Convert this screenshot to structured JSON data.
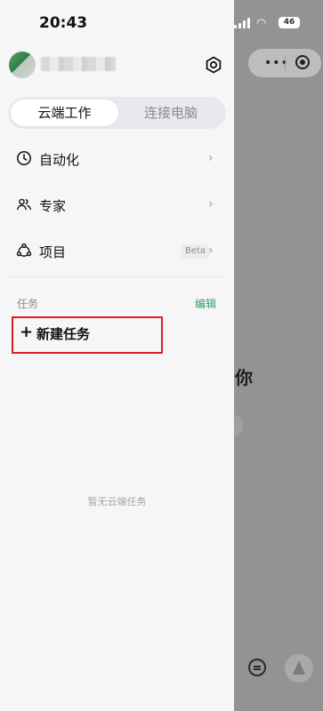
{
  "status_bar": {
    "time": "20:43",
    "battery": "46"
  },
  "background": {
    "greeting": "你"
  },
  "drawer": {
    "tabs": [
      {
        "label": "云端工作",
        "active": true
      },
      {
        "label": "连接电脑",
        "active": false
      }
    ],
    "menu": [
      {
        "label": "自动化",
        "icon": "clock-icon"
      },
      {
        "label": "专家",
        "icon": "users-icon"
      },
      {
        "label": "项目",
        "icon": "project-icon",
        "badge": "Beta"
      }
    ],
    "tasks": {
      "section_label": "任务",
      "edit_label": "编辑",
      "new_task_label": "新建任务",
      "empty_text": "暂无云端任务"
    }
  },
  "colors": {
    "accent_green": "#2ea05f",
    "highlight_red": "#d91f1f"
  }
}
